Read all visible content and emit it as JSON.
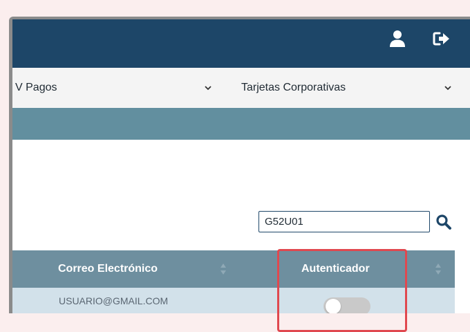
{
  "header": {
    "user_icon": "user-icon",
    "logout_icon": "sign-out-icon",
    "background_color": "#1d4668"
  },
  "menu": {
    "items": [
      {
        "label": "V Pagos",
        "icon": "chevron-down-icon"
      },
      {
        "label": "Tarjetas Corporativas",
        "icon": "chevron-down-icon"
      }
    ]
  },
  "search": {
    "value": "G52U01",
    "icon": "search-icon"
  },
  "table": {
    "headers": [
      {
        "label": "Correo Electrónico",
        "icon": "sort-icon"
      },
      {
        "label": "Autenticador",
        "icon": "sort-icon"
      }
    ],
    "rows": [
      {
        "email": "USUARIO@GMAIL.COM",
        "authenticator_enabled": false
      }
    ],
    "header_color": "#6e8f9f",
    "row_color": "#d2e1ea"
  },
  "accent_color": "#e0484f",
  "subbar_color": "#628f9f"
}
